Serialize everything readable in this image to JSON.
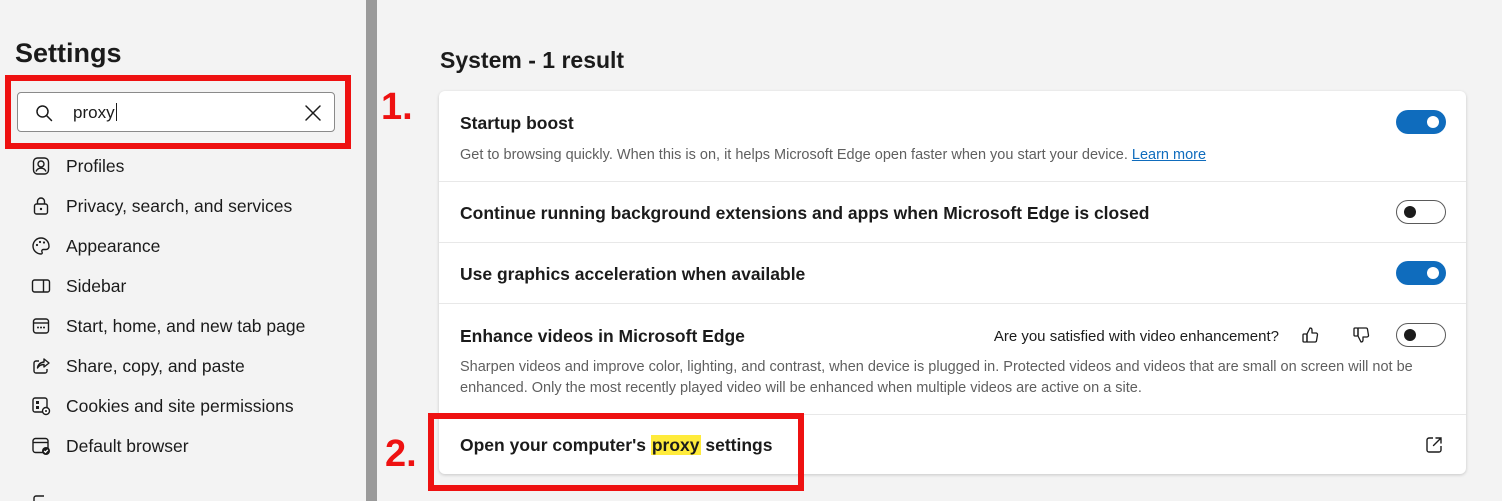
{
  "sidebar": {
    "title": "Settings",
    "search": {
      "value": "proxy",
      "placeholder": "Search settings"
    },
    "items": [
      {
        "label": "Profiles",
        "icon": "profile-icon"
      },
      {
        "label": "Privacy, search, and services",
        "icon": "lock-icon"
      },
      {
        "label": "Appearance",
        "icon": "palette-icon"
      },
      {
        "label": "Sidebar",
        "icon": "sidebar-icon"
      },
      {
        "label": "Start, home, and new tab page",
        "icon": "home-tab-icon"
      },
      {
        "label": "Share, copy, and paste",
        "icon": "share-icon"
      },
      {
        "label": "Cookies and site permissions",
        "icon": "cookies-icon"
      },
      {
        "label": "Default browser",
        "icon": "default-browser-icon"
      }
    ]
  },
  "main": {
    "section_title": "System - 1 result",
    "settings": {
      "startup_boost": {
        "title": "Startup boost",
        "description": "Get to browsing quickly. When this is on, it helps Microsoft Edge open faster when you start your device.",
        "link": "Learn more",
        "enabled": true
      },
      "background_extensions": {
        "title": "Continue running background extensions and apps when Microsoft Edge is closed",
        "enabled": false
      },
      "graphics_acceleration": {
        "title": "Use graphics acceleration when available",
        "enabled": true
      },
      "enhance_videos": {
        "title": "Enhance videos in Microsoft Edge",
        "feedback_question": "Are you satisfied with video enhancement?",
        "description": "Sharpen videos and improve color, lighting, and contrast, when device is plugged in. Protected videos and videos that are small on screen will not be enhanced. Only the most recently played video will be enhanced when multiple videos are active on a site.",
        "enabled": false
      },
      "proxy": {
        "title_before": "Open your computer's ",
        "title_highlight": "proxy",
        "title_after": " settings"
      }
    }
  },
  "annotations": {
    "step1": "1.",
    "step2": "2."
  },
  "colors": {
    "accent": "#0f6cbd",
    "annotation": "#ee1111",
    "highlight": "#ffeb3b"
  }
}
